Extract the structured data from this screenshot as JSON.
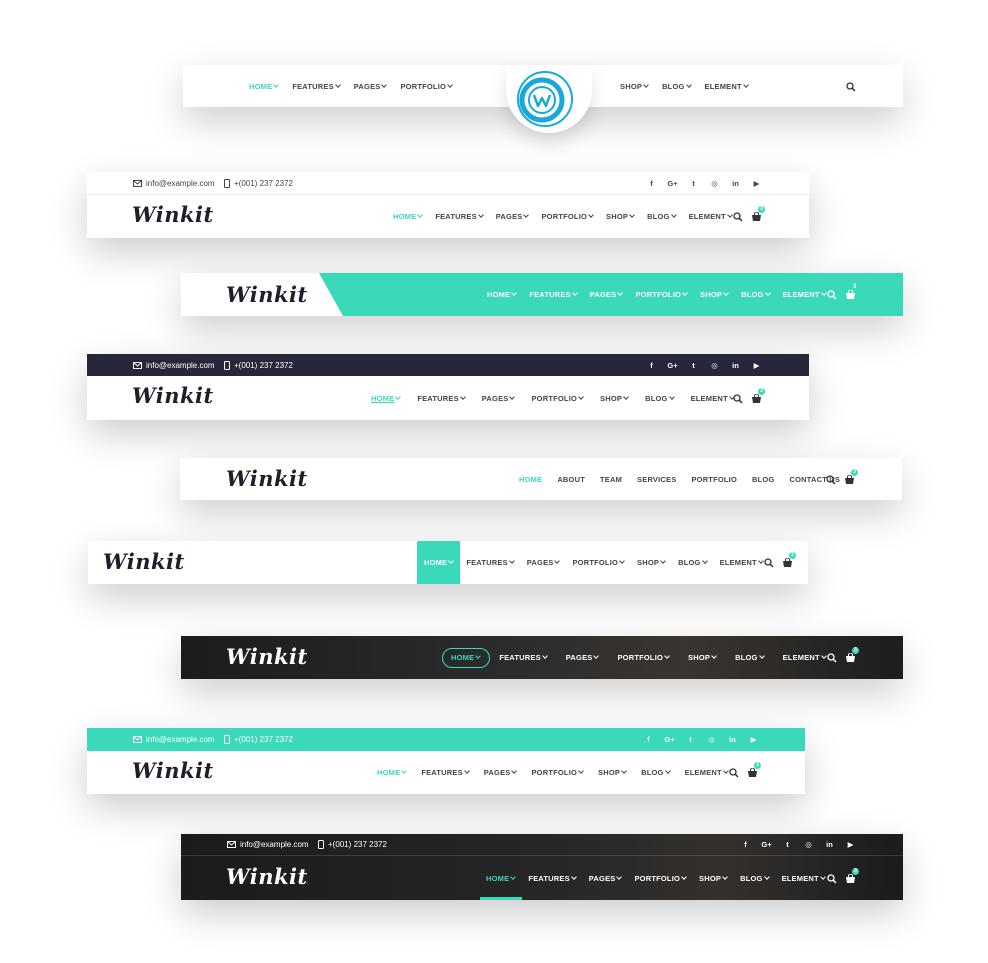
{
  "brand": {
    "logo": "Winkit",
    "circle_logo_ring": "WINKIT THEME"
  },
  "contact": {
    "email": "info@example.com",
    "phone": "+(001) 237 2372"
  },
  "social": [
    "f",
    "G+",
    "t",
    "◎",
    "in",
    "▶"
  ],
  "cart_count": "3",
  "nav_a": [
    "HOME",
    "FEATURES",
    "PAGES",
    "PORTFOLIO",
    "SHOP",
    "BLOG",
    "ELEMENT"
  ],
  "nav_left": [
    "HOME",
    "FEATURES",
    "PAGES",
    "PORTFOLIO"
  ],
  "nav_right": [
    "SHOP",
    "BLOG",
    "ELEMENT"
  ],
  "nav_onepage": [
    "HOME",
    "ABOUT",
    "TEAM",
    "SERVICES",
    "PORTFOLIO",
    "BLOG",
    "CONTACT US"
  ],
  "colors": {
    "accent": "#3ad9ba",
    "dark_bar": "#26283a",
    "dark_header": "#222222"
  }
}
